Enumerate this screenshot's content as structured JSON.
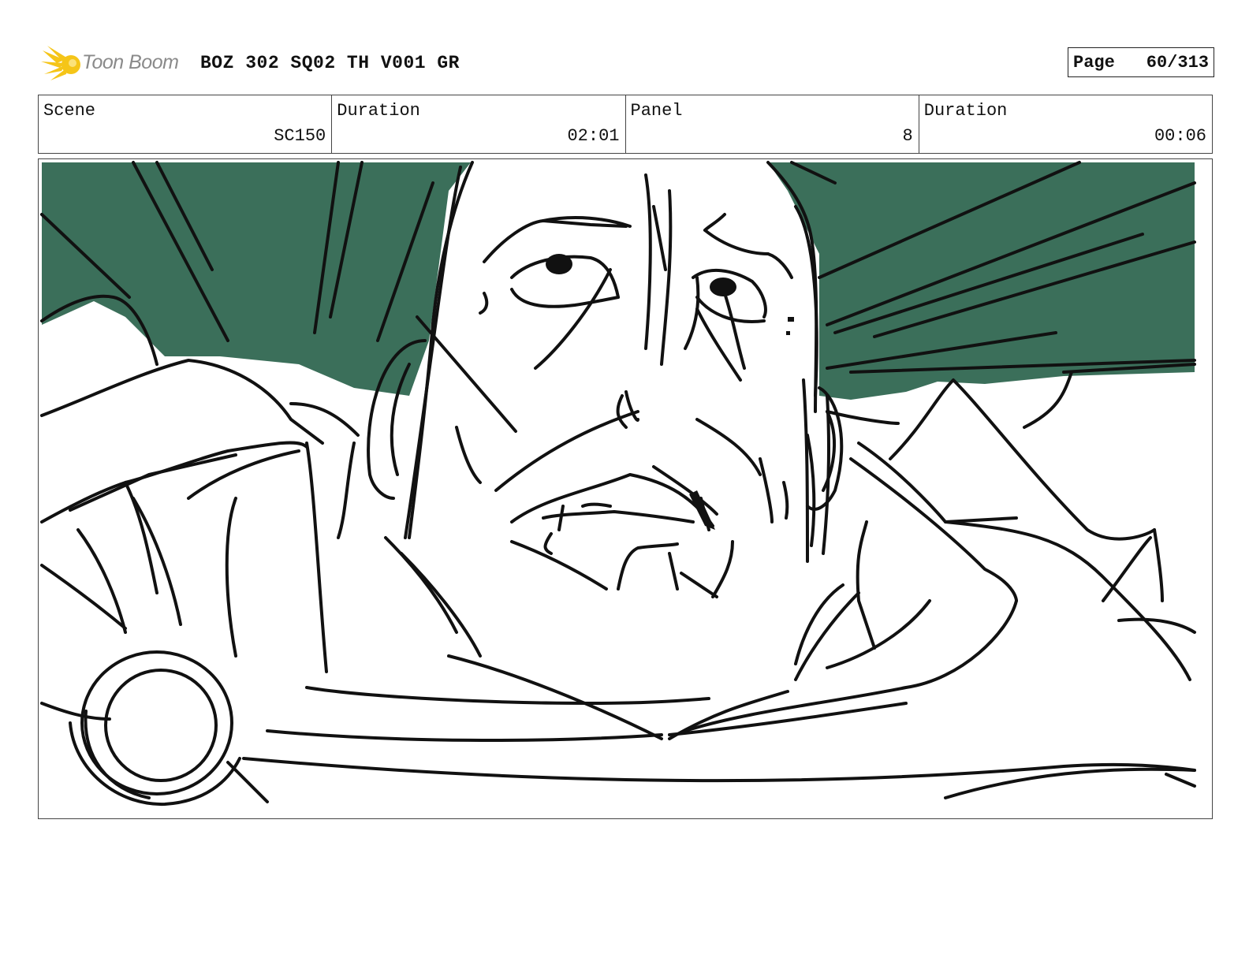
{
  "header": {
    "logo_text": "Toon Boom",
    "title": "BOZ 302 SQ02 TH V001 GR",
    "page_label": "Page",
    "page_value": "60/313"
  },
  "info": {
    "scene_label": "Scene",
    "scene_value": "SC150",
    "duration_label": "Duration",
    "duration_value": "02:01",
    "panel_label": "Panel",
    "panel_value": "8",
    "panel_duration_label": "Duration",
    "panel_duration_value": "00:06"
  },
  "colors": {
    "sky": "#3b6f5a",
    "ink": "#111111",
    "logo": "#f5c518"
  }
}
